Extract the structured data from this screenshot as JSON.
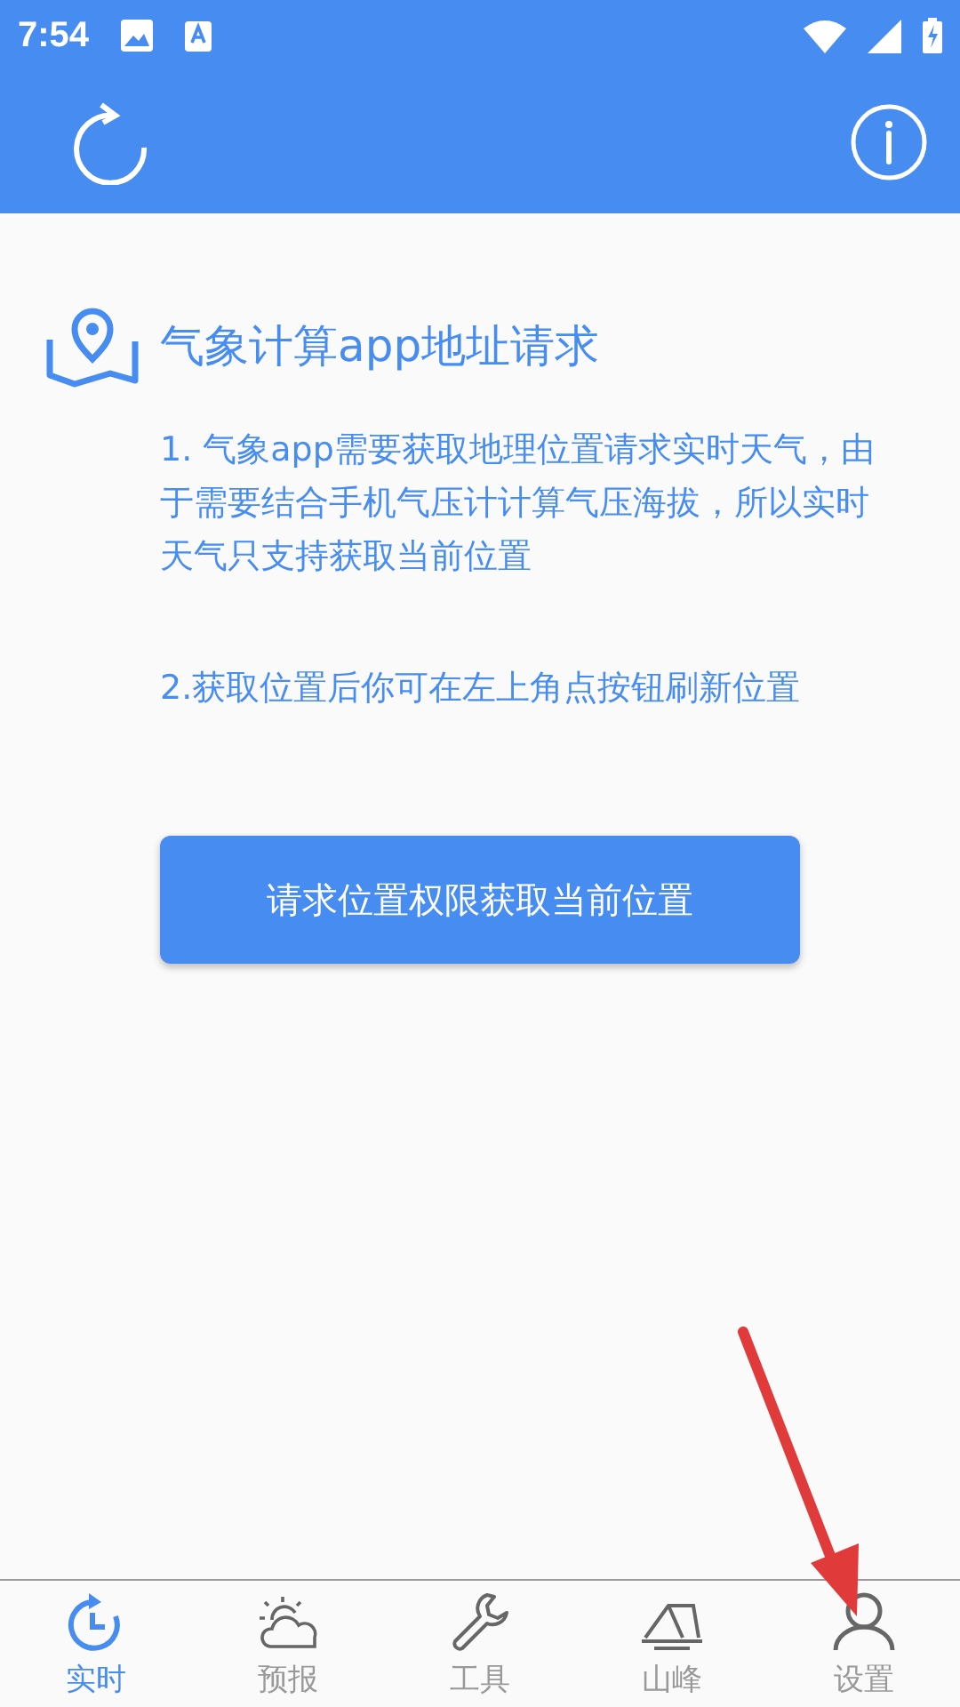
{
  "status_bar": {
    "time": "7:54"
  },
  "heading": "气象计算app地址请求",
  "paragraphs": [
    "1. 气象app需要获取地理位置请求实时天气，由于需要结合手机气压计计算气压海拔，所以实时天气只支持获取当前位置",
    "2.获取位置后你可在左上角点按钮刷新位置"
  ],
  "button": "请求位置权限获取当前位置",
  "tabs": [
    {
      "label": "实时",
      "kind": "realtime",
      "selected": true
    },
    {
      "label": "预报",
      "kind": "forecast",
      "selected": false
    },
    {
      "label": "工具",
      "kind": "tools",
      "selected": false
    },
    {
      "label": "山峰",
      "kind": "peaks",
      "selected": false
    },
    {
      "label": "设置",
      "kind": "settings",
      "selected": false
    }
  ]
}
